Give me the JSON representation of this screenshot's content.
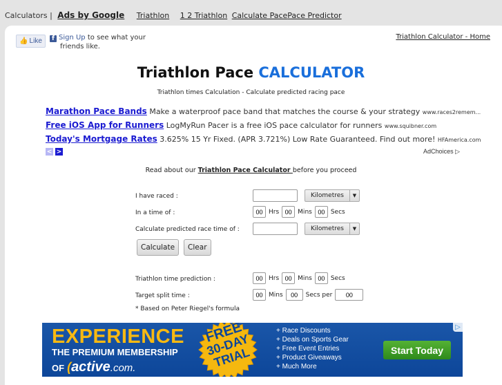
{
  "topnav": {
    "calculators": "Calculators |",
    "ads_by_google": "Ads by Google",
    "links": [
      "Triathlon",
      "1 2 Triathlon",
      "Calculate Pace",
      "Pace Predictor"
    ]
  },
  "facebook": {
    "like_label": "Like",
    "signup_link": "Sign Up",
    "signup_text": " to see what your",
    "signup_text2": "friends like."
  },
  "home_link": "Triathlon Calculator - Home",
  "header": {
    "title_black": "Triathlon Pace ",
    "title_blue": "CALCULATOR",
    "subtitle": "Triathlon times Calculation - Calculate predicted racing pace",
    "accent_color": "#1a6fdb"
  },
  "text_ads": [
    {
      "title": "Marathon Pace Bands",
      "text": " Make a waterproof pace band that matches the course & your strategy ",
      "url": "www.races2remem..."
    },
    {
      "title": "Free iOS App for Runners",
      "text": " LogMyRun Pacer is a free iOS pace calculator for runners ",
      "url": "www.squibner.com"
    },
    {
      "title": "Today's Mortgage Rates",
      "text": " 3.625% 15 Yr Fixed. (APR 3.721%) Low Rate Guaranteed. Find out more! ",
      "url": "HFAmerica.com"
    }
  ],
  "ad_nav": {
    "prev": "<",
    "next": ">",
    "adchoices": "AdChoices ▷"
  },
  "read_about": {
    "before": "Read about our ",
    "link": "Triathlon Pace Calculator ",
    "after": "before you proceed"
  },
  "form": {
    "raced_label": "I have raced :",
    "raced_value": "",
    "raced_unit": "Kilometres",
    "time_label": "In a time of :",
    "time_hrs": "00",
    "time_mins": "00",
    "time_secs": "00",
    "predict_label": "Calculate predicted race time of :",
    "predict_value": "",
    "predict_unit": "Kilometres",
    "hrs": "Hrs",
    "mins": "Mins",
    "secs": "Secs",
    "calculate_button": "Calculate",
    "clear_button": "Clear"
  },
  "results": {
    "prediction_label": "Triathlon time prediction :",
    "pred_hrs": "00",
    "pred_mins": "00",
    "pred_secs": "00",
    "split_label": "Target split time :",
    "split_mins": "00",
    "split_secs": "00",
    "split_per": "00",
    "hrs": "Hrs",
    "mins": "Mins",
    "secs": "Secs",
    "secs_per": "Secs per",
    "note": "* Based on Peter Riegel's formula"
  },
  "banner": {
    "headline": "EXPERIENCE",
    "line2": "THE PREMIUM MEMBERSHIP",
    "line3_prefix": "OF",
    "brand": "active",
    "brand_suffix": ".com.",
    "burst": [
      "FREE",
      "30-DAY",
      "TRIAL"
    ],
    "perks": [
      "+ Race Discounts",
      "+ Deals on Sports Gear",
      "+ Free Event Entries",
      "+ Product Giveaways",
      "+ Much More"
    ],
    "cta": "Start Today",
    "colors": {
      "background": "#1a56a8",
      "headline": "#f7b912",
      "cta": "#3f9e27"
    }
  }
}
